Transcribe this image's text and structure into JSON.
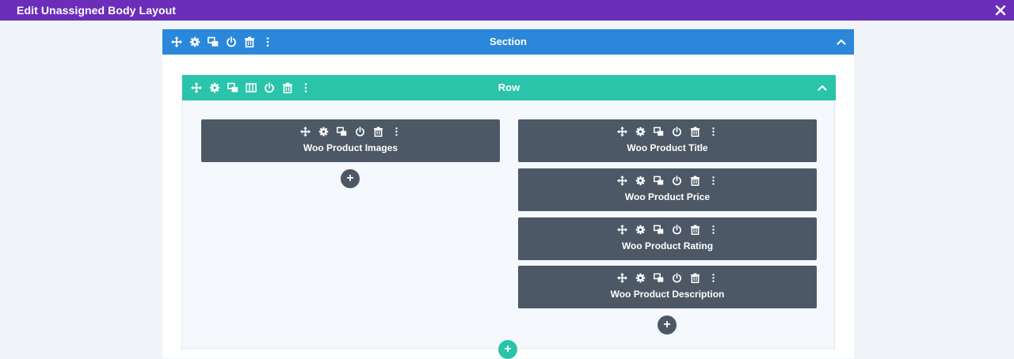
{
  "topbar": {
    "title": "Edit Unassigned Body Layout",
    "close_icon": "close-icon"
  },
  "section": {
    "label": "Section",
    "color": "#2b87da"
  },
  "row": {
    "label": "Row",
    "color": "#29c4a9"
  },
  "modules": [
    {
      "label": "Woo Product Images"
    },
    {
      "label": "Woo Product Title"
    },
    {
      "label": "Woo Product Price"
    },
    {
      "label": "Woo Product Rating"
    },
    {
      "label": "Woo Product Description"
    }
  ],
  "add_symbol": "+",
  "colors": {
    "topbar": "#6c2eb9",
    "module": "#4c5866",
    "background": "#f1f5f9"
  }
}
